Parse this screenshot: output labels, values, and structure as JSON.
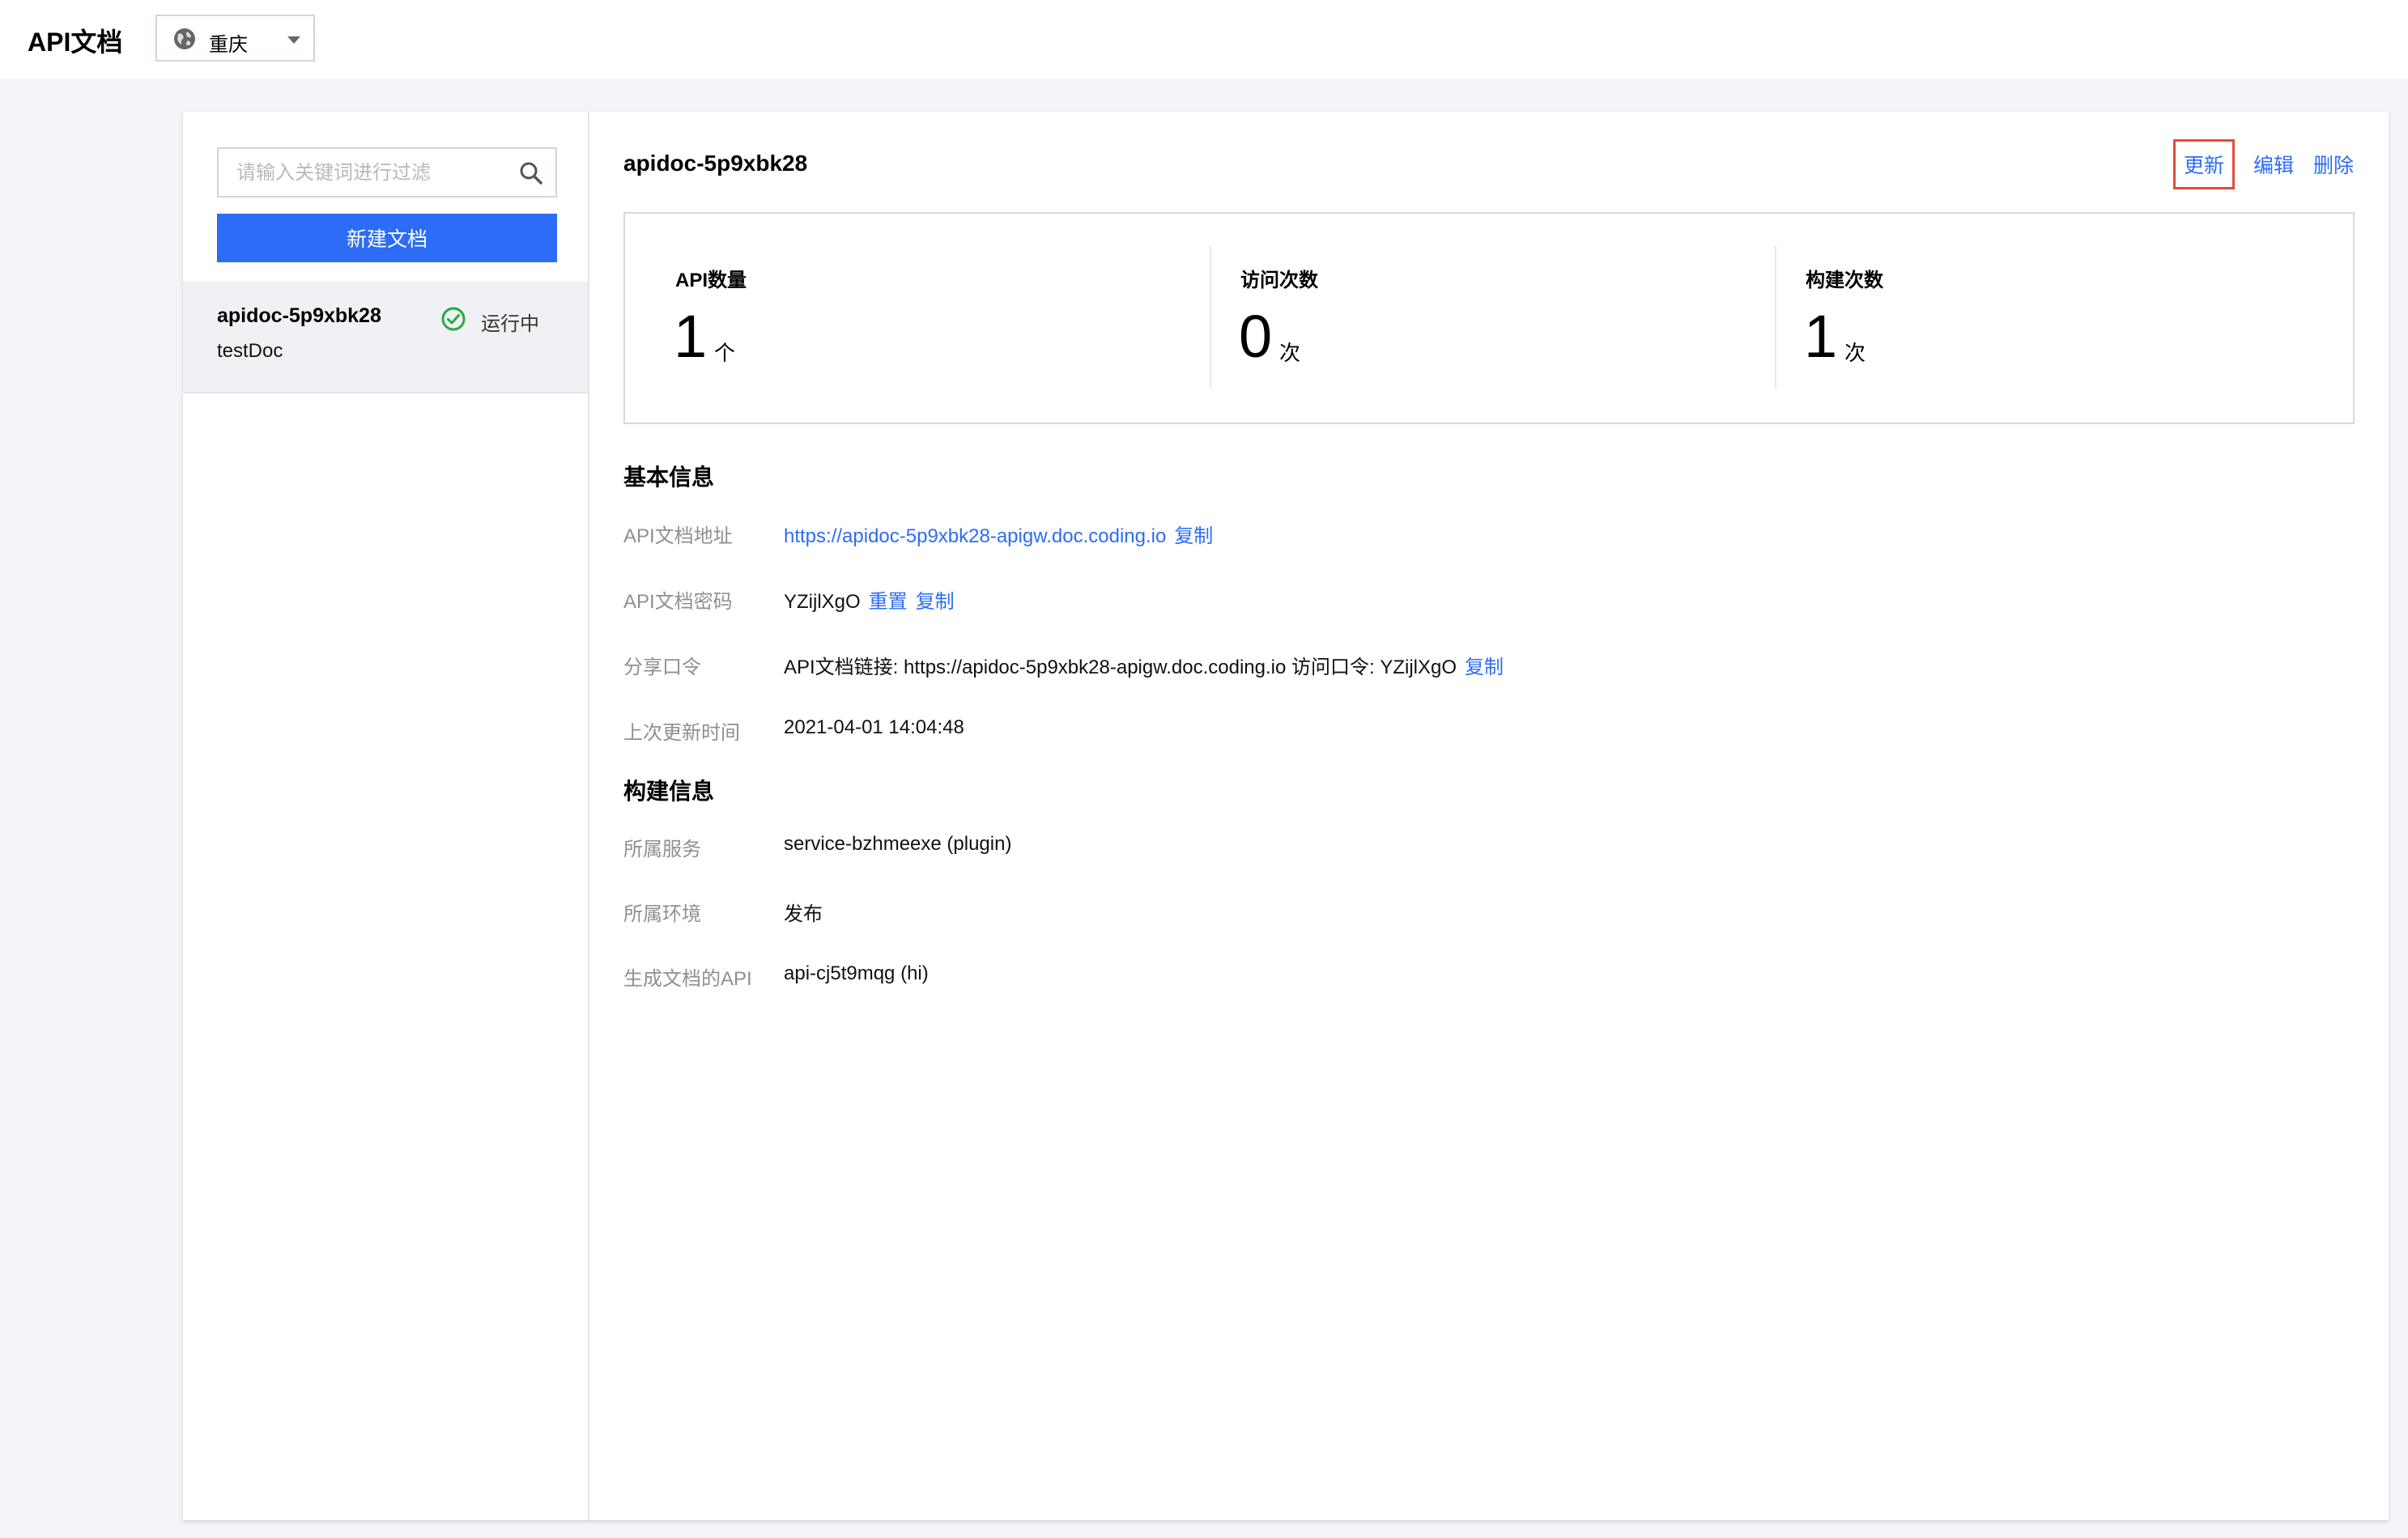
{
  "app": {
    "title": "API文档",
    "region": "重庆"
  },
  "sidebar": {
    "search_placeholder": "请输入关键词进行过滤",
    "new_doc_label": "新建文档",
    "items": [
      {
        "name": "apidoc-5p9xbk28",
        "desc": "testDoc",
        "status": "运行中"
      }
    ]
  },
  "detail": {
    "title": "apidoc-5p9xbk28",
    "actions": {
      "update": "更新",
      "edit": "编辑",
      "delete": "删除"
    },
    "stats": [
      {
        "label": "API数量",
        "value": "1",
        "unit": "个"
      },
      {
        "label": "访问次数",
        "value": "0",
        "unit": "次"
      },
      {
        "label": "构建次数",
        "value": "1",
        "unit": "次"
      }
    ],
    "basic": {
      "title": "基本信息",
      "url_label": "API文档地址",
      "url_value": "https://apidoc-5p9xbk28-apigw.doc.coding.io",
      "copy": "复制",
      "password_label": "API文档密码",
      "password_value": "YZijlXgO",
      "reset": "重置",
      "share_label": "分享口令",
      "share_value": "API文档链接: https://apidoc-5p9xbk28-apigw.doc.coding.io 访问口令: YZijlXgO",
      "updated_label": "上次更新时间",
      "updated_value": "2021-04-01 14:04:48"
    },
    "build": {
      "title": "构建信息",
      "service_label": "所属服务",
      "service_value": "service-bzhmeexe (plugin)",
      "env_label": "所属环境",
      "env_value": "发布",
      "api_label": "生成文档的API",
      "api_value": "api-cj5t9mqg (hi)"
    }
  },
  "colors": {
    "primary": "#2c6cf6",
    "success": "#2aa745",
    "highlight_border": "#e24c3a"
  }
}
